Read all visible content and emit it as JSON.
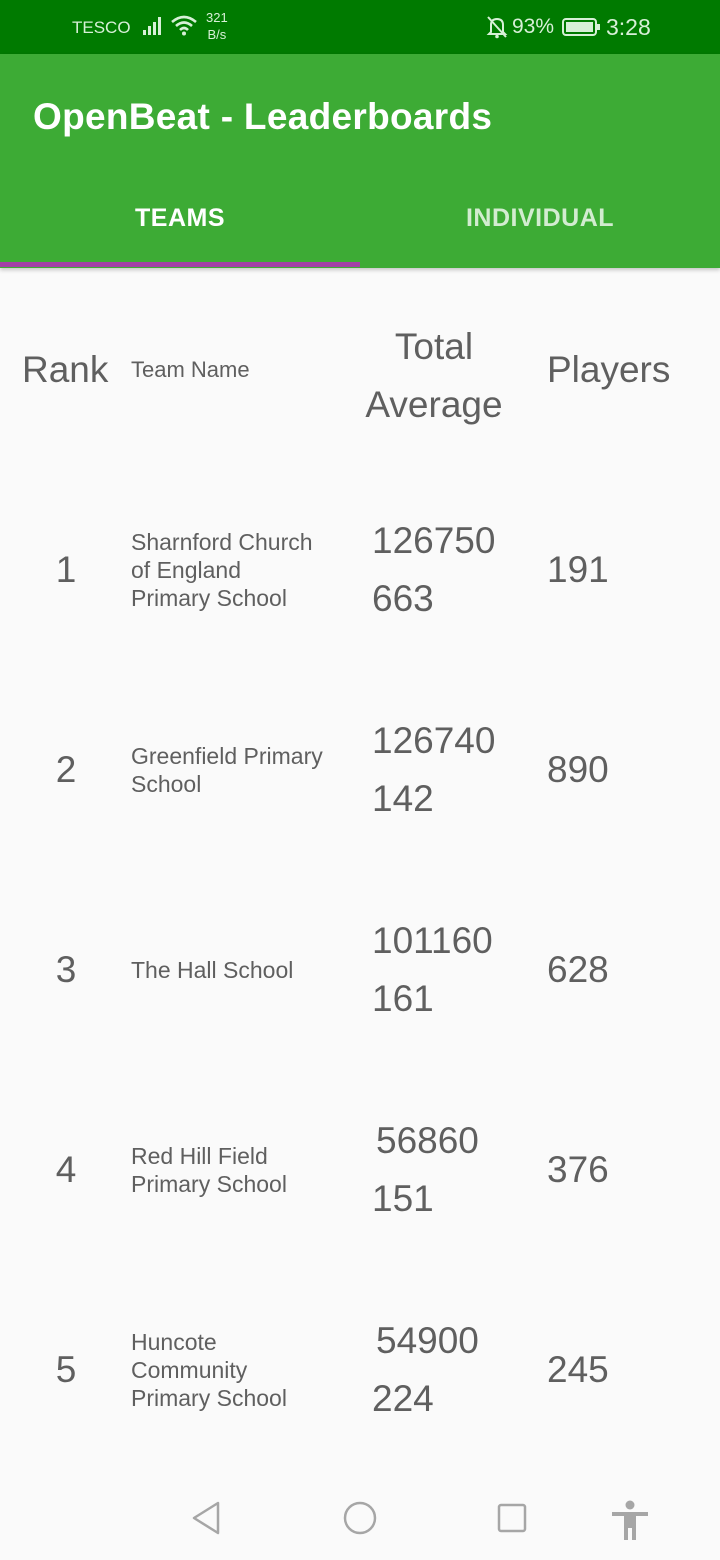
{
  "status_bar": {
    "carrier": "TESCO",
    "net_speed_value": "321",
    "net_speed_unit": "B/s",
    "battery_percent": "93%",
    "time": "3:28",
    "icons": [
      "signal-icon",
      "wifi-icon",
      "bell-off-icon",
      "battery-icon"
    ]
  },
  "app_bar": {
    "title": "OpenBeat - Leaderboards",
    "color": "#3dab35"
  },
  "tabs": [
    {
      "label": "TEAMS",
      "selected": true
    },
    {
      "label": "INDIVIDUAL",
      "selected": false
    }
  ],
  "tab_indicator_color": "#a23fa6",
  "table": {
    "headers": {
      "rank": "Rank",
      "team_name": "Team Name",
      "total_average_line1": "Total",
      "total_average_line2": "Average",
      "players": "Players"
    },
    "rows": [
      {
        "rank": "1",
        "team_lines": [
          "Sharnford Church",
          "of England",
          "Primary School"
        ],
        "total_line1": "126750",
        "total_line2": "663",
        "players": "191"
      },
      {
        "rank": "2",
        "team_lines": [
          "Greenfield Primary",
          "School"
        ],
        "total_line1": "126740",
        "total_line2": "142",
        "players": "890"
      },
      {
        "rank": "3",
        "team_lines": [
          "The Hall School"
        ],
        "total_line1": "101160",
        "total_line2": "161",
        "players": "628"
      },
      {
        "rank": "4",
        "team_lines": [
          "Red Hill Field",
          "Primary School"
        ],
        "total_line1": "56860",
        "total_line2": "151",
        "players": "376"
      },
      {
        "rank": "5",
        "team_lines": [
          "Huncote",
          "Community",
          "Primary School"
        ],
        "total_line1": "54900",
        "total_line2": "224",
        "players": "245"
      }
    ]
  },
  "nav_bar": {
    "icons": [
      "back-icon",
      "home-icon",
      "recents-icon",
      "accessibility-icon"
    ]
  }
}
